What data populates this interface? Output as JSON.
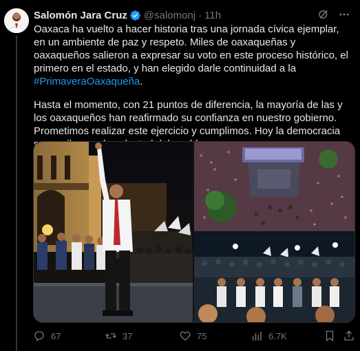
{
  "tweet": {
    "author_name": "Salomón Jara Cruz",
    "handle": "@salomonj",
    "separator": "·",
    "time": "11h",
    "paragraph1_text": "Oaxaca ha vuelto a hacer historia tras una jornada cívica ejemplar, en un ambiente de paz y respeto. Miles de oaxaqueñas y oaxaqueños salieron a expresar su voto en este proceso histórico, el primero en el estado, y han elegido darle continuidad a la ",
    "hashtag": "#PrimaveraOaxaqueña",
    "paragraph1_end": ".",
    "paragraph2": "Hasta el momento, con 21 puntos de diferencia, la mayoría de las y los oaxaqueños han reafirmado su confianza en nuestro gobierno. Prometimos realizar este ejercicio y cumplimos. Hoy la democracia se escribe con la voluntad del pueblo."
  },
  "stats": {
    "replies": "67",
    "reposts": "37",
    "likes": "75",
    "views": "6.7K"
  },
  "colors": {
    "background": "#000000",
    "text": "#e7e9ea",
    "muted": "#71767b",
    "link": "#1d9bf0",
    "verified": "#1d9bf0"
  },
  "icons": [
    "verified-badge-icon",
    "grok-icon",
    "more-icon",
    "reply-icon",
    "repost-icon",
    "like-icon",
    "views-icon",
    "bookmark-icon",
    "share-icon"
  ]
}
